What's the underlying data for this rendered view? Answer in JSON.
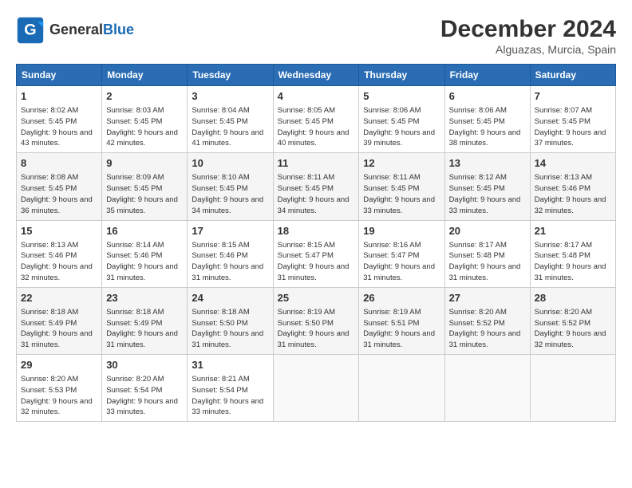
{
  "logo": {
    "line1": "General",
    "line2": "Blue"
  },
  "header": {
    "month_year": "December 2024",
    "location": "Alguazas, Murcia, Spain"
  },
  "weekdays": [
    "Sunday",
    "Monday",
    "Tuesday",
    "Wednesday",
    "Thursday",
    "Friday",
    "Saturday"
  ],
  "weeks": [
    [
      {
        "day": "1",
        "sunrise": "Sunrise: 8:02 AM",
        "sunset": "Sunset: 5:45 PM",
        "daylight": "Daylight: 9 hours and 43 minutes."
      },
      {
        "day": "2",
        "sunrise": "Sunrise: 8:03 AM",
        "sunset": "Sunset: 5:45 PM",
        "daylight": "Daylight: 9 hours and 42 minutes."
      },
      {
        "day": "3",
        "sunrise": "Sunrise: 8:04 AM",
        "sunset": "Sunset: 5:45 PM",
        "daylight": "Daylight: 9 hours and 41 minutes."
      },
      {
        "day": "4",
        "sunrise": "Sunrise: 8:05 AM",
        "sunset": "Sunset: 5:45 PM",
        "daylight": "Daylight: 9 hours and 40 minutes."
      },
      {
        "day": "5",
        "sunrise": "Sunrise: 8:06 AM",
        "sunset": "Sunset: 5:45 PM",
        "daylight": "Daylight: 9 hours and 39 minutes."
      },
      {
        "day": "6",
        "sunrise": "Sunrise: 8:06 AM",
        "sunset": "Sunset: 5:45 PM",
        "daylight": "Daylight: 9 hours and 38 minutes."
      },
      {
        "day": "7",
        "sunrise": "Sunrise: 8:07 AM",
        "sunset": "Sunset: 5:45 PM",
        "daylight": "Daylight: 9 hours and 37 minutes."
      }
    ],
    [
      {
        "day": "8",
        "sunrise": "Sunrise: 8:08 AM",
        "sunset": "Sunset: 5:45 PM",
        "daylight": "Daylight: 9 hours and 36 minutes."
      },
      {
        "day": "9",
        "sunrise": "Sunrise: 8:09 AM",
        "sunset": "Sunset: 5:45 PM",
        "daylight": "Daylight: 9 hours and 35 minutes."
      },
      {
        "day": "10",
        "sunrise": "Sunrise: 8:10 AM",
        "sunset": "Sunset: 5:45 PM",
        "daylight": "Daylight: 9 hours and 34 minutes."
      },
      {
        "day": "11",
        "sunrise": "Sunrise: 8:11 AM",
        "sunset": "Sunset: 5:45 PM",
        "daylight": "Daylight: 9 hours and 34 minutes."
      },
      {
        "day": "12",
        "sunrise": "Sunrise: 8:11 AM",
        "sunset": "Sunset: 5:45 PM",
        "daylight": "Daylight: 9 hours and 33 minutes."
      },
      {
        "day": "13",
        "sunrise": "Sunrise: 8:12 AM",
        "sunset": "Sunset: 5:45 PM",
        "daylight": "Daylight: 9 hours and 33 minutes."
      },
      {
        "day": "14",
        "sunrise": "Sunrise: 8:13 AM",
        "sunset": "Sunset: 5:46 PM",
        "daylight": "Daylight: 9 hours and 32 minutes."
      }
    ],
    [
      {
        "day": "15",
        "sunrise": "Sunrise: 8:13 AM",
        "sunset": "Sunset: 5:46 PM",
        "daylight": "Daylight: 9 hours and 32 minutes."
      },
      {
        "day": "16",
        "sunrise": "Sunrise: 8:14 AM",
        "sunset": "Sunset: 5:46 PM",
        "daylight": "Daylight: 9 hours and 31 minutes."
      },
      {
        "day": "17",
        "sunrise": "Sunrise: 8:15 AM",
        "sunset": "Sunset: 5:46 PM",
        "daylight": "Daylight: 9 hours and 31 minutes."
      },
      {
        "day": "18",
        "sunrise": "Sunrise: 8:15 AM",
        "sunset": "Sunset: 5:47 PM",
        "daylight": "Daylight: 9 hours and 31 minutes."
      },
      {
        "day": "19",
        "sunrise": "Sunrise: 8:16 AM",
        "sunset": "Sunset: 5:47 PM",
        "daylight": "Daylight: 9 hours and 31 minutes."
      },
      {
        "day": "20",
        "sunrise": "Sunrise: 8:17 AM",
        "sunset": "Sunset: 5:48 PM",
        "daylight": "Daylight: 9 hours and 31 minutes."
      },
      {
        "day": "21",
        "sunrise": "Sunrise: 8:17 AM",
        "sunset": "Sunset: 5:48 PM",
        "daylight": "Daylight: 9 hours and 31 minutes."
      }
    ],
    [
      {
        "day": "22",
        "sunrise": "Sunrise: 8:18 AM",
        "sunset": "Sunset: 5:49 PM",
        "daylight": "Daylight: 9 hours and 31 minutes."
      },
      {
        "day": "23",
        "sunrise": "Sunrise: 8:18 AM",
        "sunset": "Sunset: 5:49 PM",
        "daylight": "Daylight: 9 hours and 31 minutes."
      },
      {
        "day": "24",
        "sunrise": "Sunrise: 8:18 AM",
        "sunset": "Sunset: 5:50 PM",
        "daylight": "Daylight: 9 hours and 31 minutes."
      },
      {
        "day": "25",
        "sunrise": "Sunrise: 8:19 AM",
        "sunset": "Sunset: 5:50 PM",
        "daylight": "Daylight: 9 hours and 31 minutes."
      },
      {
        "day": "26",
        "sunrise": "Sunrise: 8:19 AM",
        "sunset": "Sunset: 5:51 PM",
        "daylight": "Daylight: 9 hours and 31 minutes."
      },
      {
        "day": "27",
        "sunrise": "Sunrise: 8:20 AM",
        "sunset": "Sunset: 5:52 PM",
        "daylight": "Daylight: 9 hours and 31 minutes."
      },
      {
        "day": "28",
        "sunrise": "Sunrise: 8:20 AM",
        "sunset": "Sunset: 5:52 PM",
        "daylight": "Daylight: 9 hours and 32 minutes."
      }
    ],
    [
      {
        "day": "29",
        "sunrise": "Sunrise: 8:20 AM",
        "sunset": "Sunset: 5:53 PM",
        "daylight": "Daylight: 9 hours and 32 minutes."
      },
      {
        "day": "30",
        "sunrise": "Sunrise: 8:20 AM",
        "sunset": "Sunset: 5:54 PM",
        "daylight": "Daylight: 9 hours and 33 minutes."
      },
      {
        "day": "31",
        "sunrise": "Sunrise: 8:21 AM",
        "sunset": "Sunset: 5:54 PM",
        "daylight": "Daylight: 9 hours and 33 minutes."
      },
      null,
      null,
      null,
      null
    ]
  ]
}
